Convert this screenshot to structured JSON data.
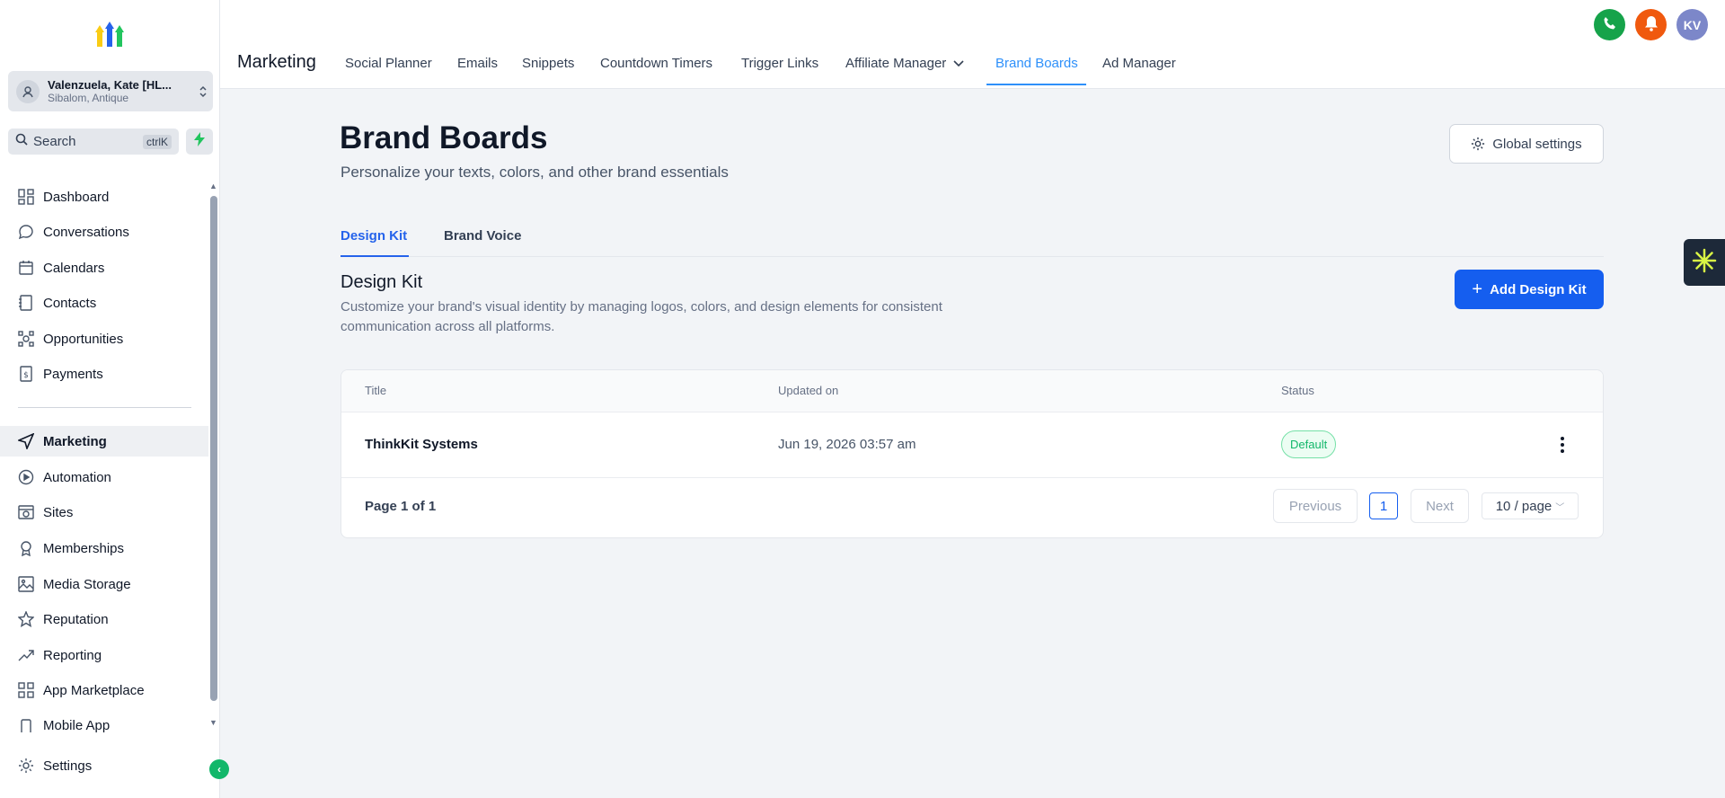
{
  "sidebar": {
    "account": {
      "name": "Valenzuela, Kate [HL...",
      "location": "Sibalom, Antique"
    },
    "search": {
      "label": "Search",
      "shortcut": "ctrlK"
    },
    "items": [
      {
        "label": "Dashboard",
        "icon": "dashboard-icon"
      },
      {
        "label": "Conversations",
        "icon": "chat-icon"
      },
      {
        "label": "Calendars",
        "icon": "calendar-icon"
      },
      {
        "label": "Contacts",
        "icon": "contacts-icon"
      },
      {
        "label": "Opportunities",
        "icon": "opportunities-icon"
      },
      {
        "label": "Payments",
        "icon": "payments-icon"
      },
      {
        "label": "Marketing",
        "icon": "send-icon",
        "active": true
      },
      {
        "label": "Automation",
        "icon": "automation-icon"
      },
      {
        "label": "Sites",
        "icon": "sites-icon"
      },
      {
        "label": "Memberships",
        "icon": "memberships-icon"
      },
      {
        "label": "Media Storage",
        "icon": "image-icon"
      },
      {
        "label": "Reputation",
        "icon": "star-icon"
      },
      {
        "label": "Reporting",
        "icon": "trend-icon"
      },
      {
        "label": "App Marketplace",
        "icon": "grid-icon"
      },
      {
        "label": "Mobile App",
        "icon": "mobile-icon"
      }
    ],
    "settings": "Settings"
  },
  "header": {
    "section": "Marketing",
    "tabs": [
      {
        "label": "Social Planner"
      },
      {
        "label": "Emails"
      },
      {
        "label": "Snippets"
      },
      {
        "label": "Countdown Timers"
      },
      {
        "label": "Trigger Links"
      },
      {
        "label": "Affiliate Manager"
      },
      {
        "label": "Brand Boards",
        "active": true
      },
      {
        "label": "Ad Manager"
      }
    ],
    "user_initials": "KV",
    "colors": {
      "phone": "#16a34a",
      "bell": "#f0590e",
      "avatar": "#7c87c9",
      "accent": "#2e90fa"
    }
  },
  "main": {
    "title": "Brand Boards",
    "subtitle": "Personalize your texts, colors, and other brand essentials",
    "global_settings": "Global settings",
    "tabs": [
      {
        "label": "Design Kit",
        "active": true
      },
      {
        "label": "Brand Voice"
      }
    ],
    "design_kit": {
      "title": "Design Kit",
      "description": "Customize your brand's visual identity by managing logos, colors, and design elements for consistent communication across all platforms.",
      "add_button": "Add Design Kit"
    },
    "table": {
      "columns": [
        "Title",
        "Updated on",
        "Status"
      ],
      "rows": [
        {
          "title": "ThinkKit Systems",
          "updated": "Jun 19, 2026 03:57 am",
          "status": "Default"
        }
      ]
    },
    "pagination": {
      "label": "Page 1 of 1",
      "previous": "Previous",
      "current": "1",
      "next": "Next",
      "page_size": "10 / page"
    }
  }
}
